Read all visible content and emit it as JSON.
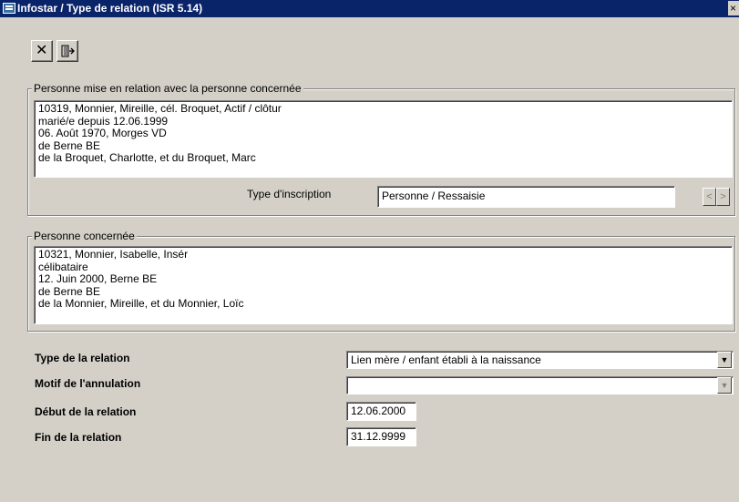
{
  "window": {
    "title": "Infostar / Type de relation (ISR 5.14)",
    "close_glyph": "×"
  },
  "toolbar": {
    "close_glyph": "✕",
    "exit_glyph": "⇱"
  },
  "person_related": {
    "legend": "Personne mise en relation avec la personne concernée",
    "lines": [
      "10319, Monnier, Mireille, cél. Broquet, Actif / clôtur",
      "marié/e depuis 12.06.1999",
      "06. Août 1970, Morges VD",
      "de Berne BE",
      "de la Broquet, Charlotte, et du Broquet, Marc"
    ],
    "inscription_label": "Type d'inscription",
    "inscription_value": "Personne / Ressaisie",
    "prev_glyph": "<",
    "next_glyph": ">"
  },
  "person_concerned": {
    "legend": "Personne concernée",
    "lines": [
      "10321, Monnier, Isabelle, Insér",
      "célibataire",
      "12. Juin 2000, Berne BE",
      "de Berne BE",
      "de la Monnier, Mireille, et du Monnier, Loïc"
    ]
  },
  "form": {
    "relation_type_label": "Type de la relation",
    "relation_type_value": "Lien mère / enfant établi à la naissance",
    "cancel_reason_label": "Motif de l'annulation",
    "cancel_reason_value": "",
    "start_label": "Début de la relation",
    "start_value": "12.06.2000",
    "end_label": "Fin de la relation",
    "end_value": "31.12.9999",
    "dropdown_glyph": "▼"
  }
}
